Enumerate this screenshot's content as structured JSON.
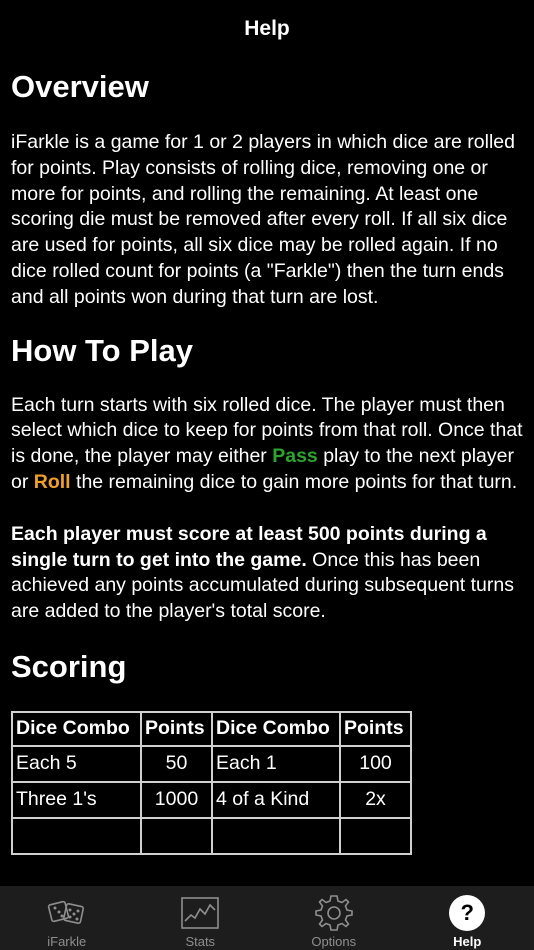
{
  "navbar": {
    "title": "Help"
  },
  "sections": {
    "overview": {
      "heading": "Overview",
      "text": "iFarkle is a game for 1 or 2 players in which dice are rolled for points. Play consists of rolling dice, removing one or more for points, and rolling the remaining. At least one scoring die must be removed after every roll. If all six dice are used for points, all six dice may be rolled again. If no dice rolled count for points (a \"Farkle\") then the turn ends and all points won during that turn are lost."
    },
    "how_to_play": {
      "heading": "How To Play",
      "p1_part1": "Each turn starts with six rolled dice. The player must then select which dice to keep for points from that roll. Once that is done, the player may either ",
      "pass_word": "Pass",
      "p1_part2": " play to the next player or ",
      "roll_word": "Roll",
      "p1_part3": " the remaining dice to gain more points for that turn.",
      "p2_bold": "Each player must score at least 500 points during a single turn to get into the game.",
      "p2_rest": " Once this has been achieved any points accumulated during subsequent turns are added to the player's total score."
    },
    "scoring": {
      "heading": "Scoring",
      "headers": [
        "Dice Combo",
        "Points",
        "Dice Combo",
        "Points"
      ],
      "rows": [
        [
          "Each 5",
          "50",
          "Each 1",
          "100"
        ],
        [
          "Three 1's",
          "1000",
          "4 of a Kind",
          "2x"
        ]
      ]
    }
  },
  "tabbar": {
    "tabs": [
      {
        "label": "iFarkle",
        "icon": "dice-icon"
      },
      {
        "label": "Stats",
        "icon": "chart-icon"
      },
      {
        "label": "Options",
        "icon": "gear-icon"
      },
      {
        "label": "Help",
        "icon": "help-icon"
      }
    ],
    "active_index": 3
  },
  "colors": {
    "pass": "#2ca52c",
    "roll": "#f0a028",
    "tabbar_bg": "#1d1d1d"
  }
}
